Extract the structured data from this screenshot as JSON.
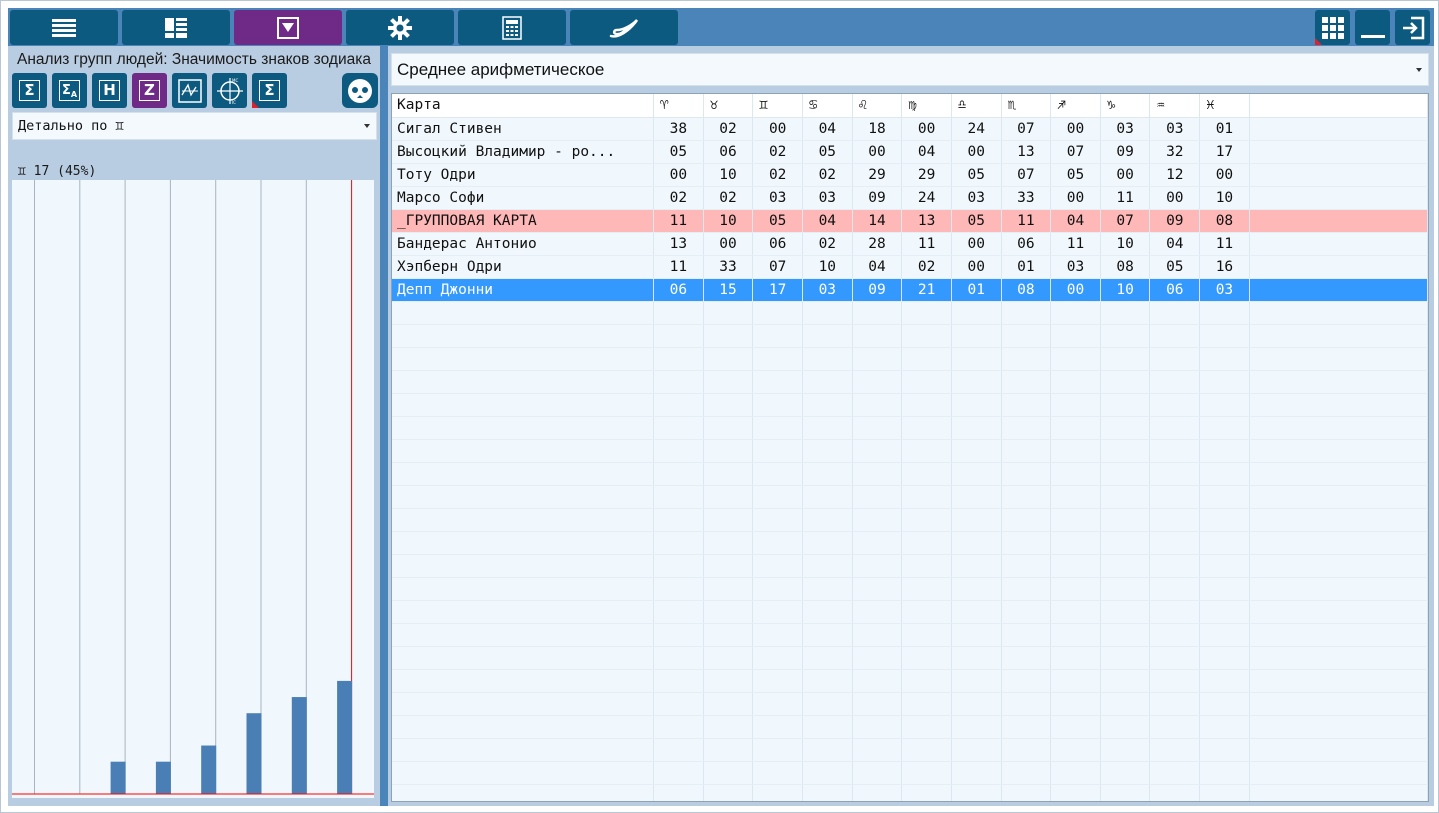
{
  "panel": {
    "title": "Анализ групп людей: Значимость знаков зодиака",
    "detail_select": "Детально по ♊"
  },
  "table_mode": "Среднее арифметическое",
  "colors": {
    "toolbar": "#4a84b9",
    "button": "#0c5a80",
    "button_active": "#6e2a86",
    "row_group": "#ffb8b8",
    "row_selected": "#3399ff",
    "bar": "#4a7fb5",
    "bar_highlight": "#ff0000"
  },
  "toolbar_icons": [
    "menu-icon",
    "layout-icon",
    "dropdown-icon",
    "gear-icon",
    "calculator-icon",
    "logo-icon"
  ],
  "chart_data": {
    "type": "bar",
    "title": "♊ 17 (45%)",
    "categories": [
      "Сигал Стивен",
      "Высоцкий Владимир - ро...",
      "Тоту Одри",
      "Марсо Софи",
      "_ГРУППОВАЯ КАРТА",
      "Бандерас Антонио",
      "Хэпберн Одри",
      "Депп Джонни"
    ],
    "values": [
      0,
      2,
      2,
      3,
      5,
      6,
      7,
      17
    ],
    "highlight_index": 7,
    "ylim": [
      0,
      38
    ],
    "grid": true
  },
  "table": {
    "name_header": "Карта",
    "signs": [
      "♈",
      "♉",
      "♊",
      "♋",
      "♌",
      "♍",
      "♎",
      "♏",
      "♐",
      "♑",
      "♒",
      "♓"
    ],
    "rows": [
      {
        "name": "Сигал Стивен",
        "values": [
          "38",
          "02",
          "00",
          "04",
          "18",
          "00",
          "24",
          "07",
          "00",
          "03",
          "03",
          "01"
        ],
        "kind": "normal"
      },
      {
        "name": "Высоцкий Владимир - ро...",
        "values": [
          "05",
          "06",
          "02",
          "05",
          "00",
          "04",
          "00",
          "13",
          "07",
          "09",
          "32",
          "17"
        ],
        "kind": "normal"
      },
      {
        "name": "Тоту Одри",
        "values": [
          "00",
          "10",
          "02",
          "02",
          "29",
          "29",
          "05",
          "07",
          "05",
          "00",
          "12",
          "00"
        ],
        "kind": "normal"
      },
      {
        "name": "Марсо Софи",
        "values": [
          "02",
          "02",
          "03",
          "03",
          "09",
          "24",
          "03",
          "33",
          "00",
          "11",
          "00",
          "10"
        ],
        "kind": "normal"
      },
      {
        "name": "_ГРУППОВАЯ КАРТА",
        "values": [
          "11",
          "10",
          "05",
          "04",
          "14",
          "13",
          "05",
          "11",
          "04",
          "07",
          "09",
          "08"
        ],
        "kind": "group"
      },
      {
        "name": "Бандерас Антонио",
        "values": [
          "13",
          "00",
          "06",
          "02",
          "28",
          "11",
          "00",
          "06",
          "11",
          "10",
          "04",
          "11"
        ],
        "kind": "normal"
      },
      {
        "name": "Хэпберн Одри",
        "values": [
          "11",
          "33",
          "07",
          "10",
          "04",
          "02",
          "00",
          "01",
          "03",
          "08",
          "05",
          "16"
        ],
        "kind": "normal"
      },
      {
        "name": "Депп Джонни",
        "values": [
          "06",
          "15",
          "17",
          "03",
          "09",
          "21",
          "01",
          "08",
          "00",
          "10",
          "06",
          "03"
        ],
        "kind": "selected"
      }
    ]
  }
}
